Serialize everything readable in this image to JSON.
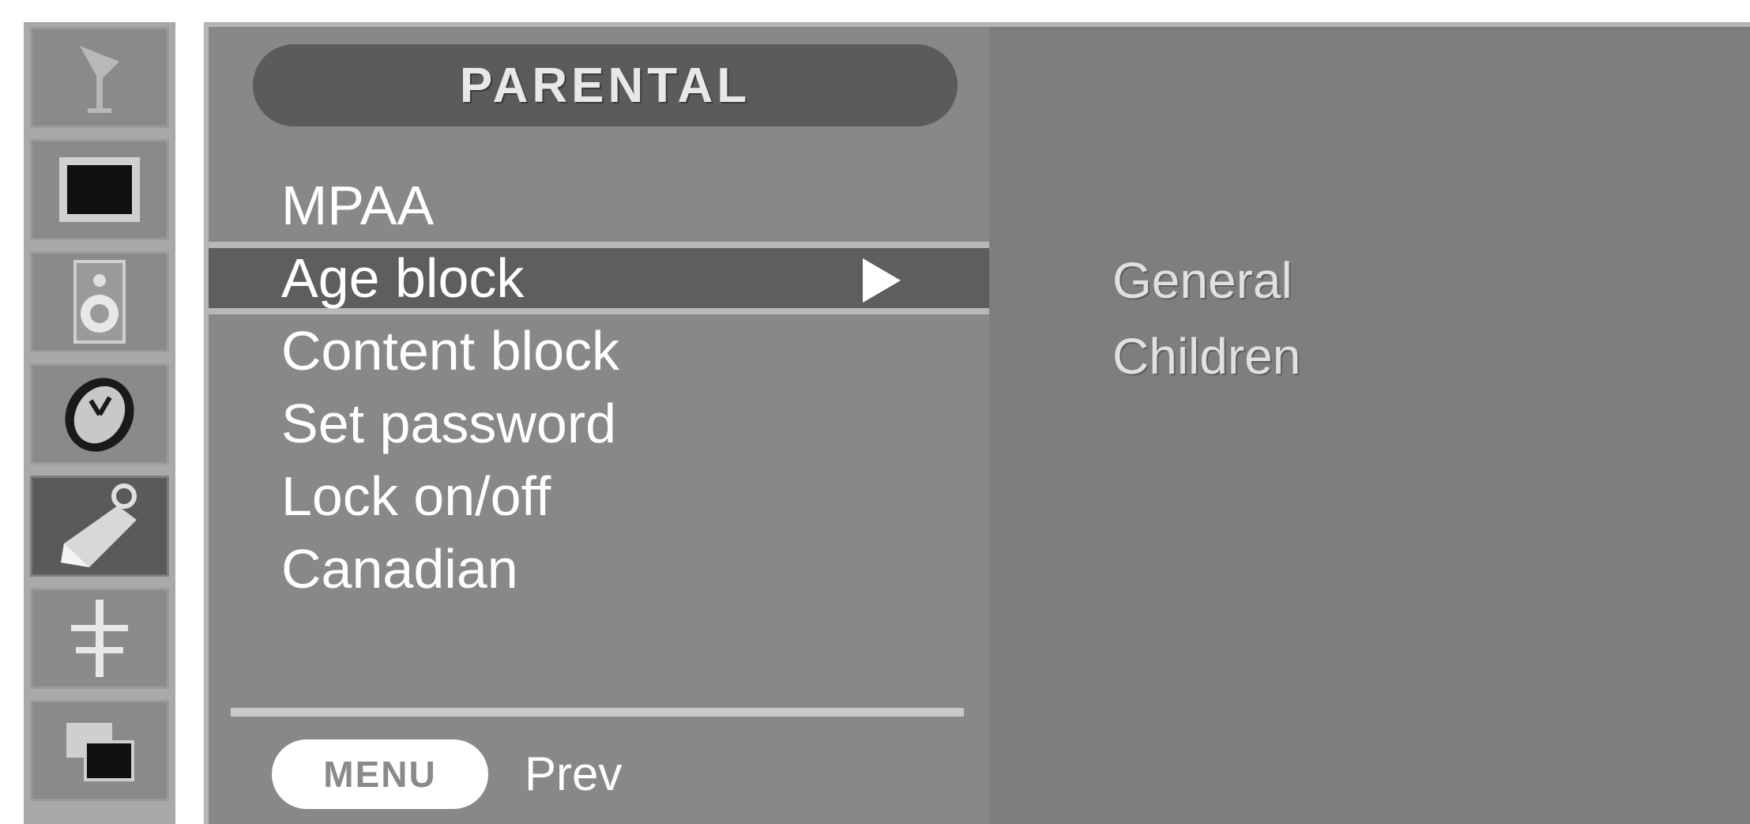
{
  "sidebar": {
    "icons": [
      {
        "name": "antenna-icon",
        "selected": false
      },
      {
        "name": "picture-icon",
        "selected": false
      },
      {
        "name": "speaker-icon",
        "selected": false
      },
      {
        "name": "time-icon",
        "selected": false
      },
      {
        "name": "lock-tag-icon",
        "selected": true
      },
      {
        "name": "option-icon",
        "selected": false
      },
      {
        "name": "pip-icon",
        "selected": false
      }
    ]
  },
  "menu": {
    "title": "PARENTAL",
    "items": [
      "MPAA",
      "Age block",
      "Content block",
      "Set password",
      "Lock on/off",
      "Canadian"
    ],
    "selected_index": 1
  },
  "footer": {
    "menu_button": "MENU",
    "prev_label": "Prev"
  },
  "submenu": {
    "items": [
      "General",
      "Children"
    ]
  },
  "colors": {
    "panel": "#888888",
    "selected_row": "#5e5e5e",
    "submenu_panel": "#7e7e7e",
    "text": "#ffffff"
  }
}
